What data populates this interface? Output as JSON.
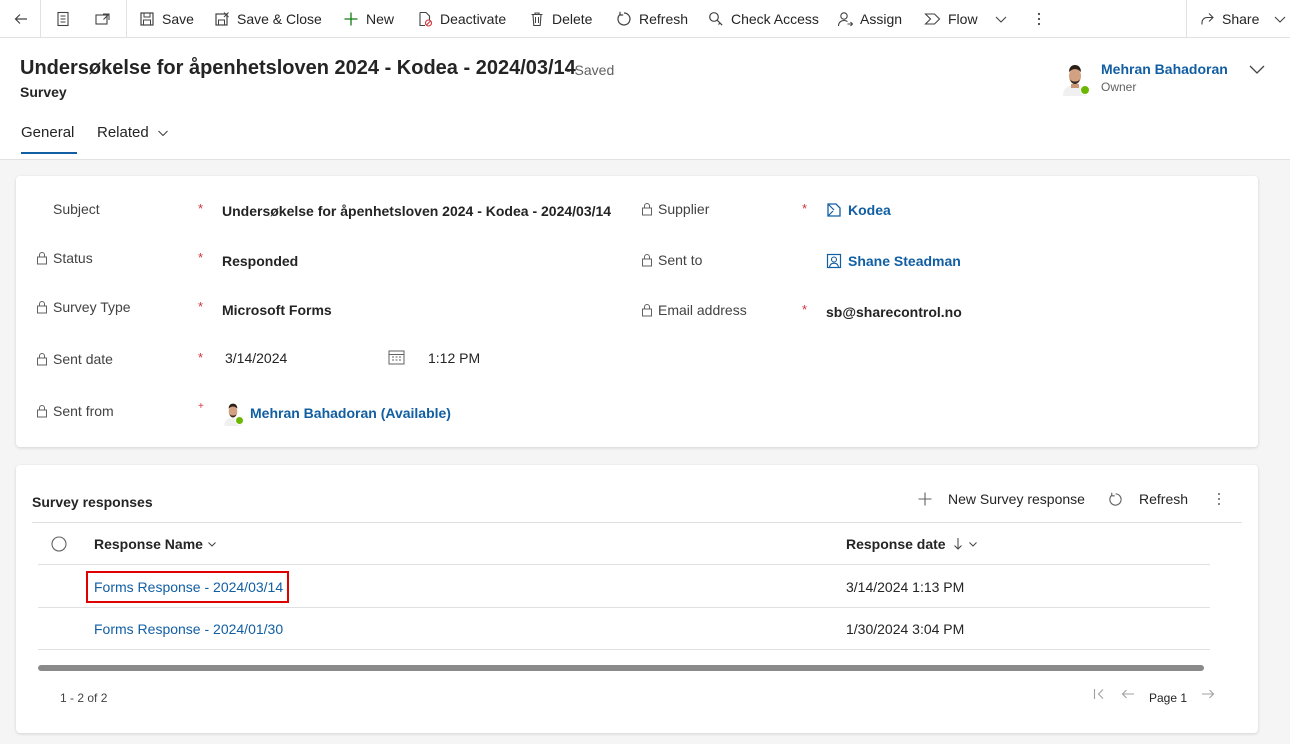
{
  "commandbar": {
    "back_icon": "arrow-left-icon",
    "form_icon": "form-icon",
    "popout_icon": "open-in-new-window-icon",
    "save": "Save",
    "save_close": "Save & Close",
    "new": "New",
    "deactivate": "Deactivate",
    "delete": "Delete",
    "refresh": "Refresh",
    "check_access": "Check Access",
    "assign": "Assign",
    "flow": "Flow",
    "share": "Share"
  },
  "header": {
    "title": "Undersøkelse for åpenhetsloven 2024 - Kodea - 2024/03/14",
    "saved_status": "- Saved",
    "entity": "Survey",
    "owner_name": "Mehran Bahadoran",
    "owner_label": "Owner",
    "presence_color": "#6bb700"
  },
  "tabs": [
    {
      "label": "General",
      "selected": true
    },
    {
      "label": "Related",
      "selected": false
    }
  ],
  "form": {
    "subject": {
      "label": "Subject",
      "value": "Undersøkelse for åpenhetsloven 2024 - Kodea - 2024/03/14",
      "required": "*"
    },
    "status": {
      "label": "Status",
      "value": "Responded",
      "required": "*"
    },
    "survey_type": {
      "label": "Survey Type",
      "value": "Microsoft Forms",
      "required": "*"
    },
    "sent_date": {
      "label": "Sent date",
      "date": "3/14/2024",
      "time": "1:12 PM",
      "required": "*"
    },
    "sent_from": {
      "label": "Sent from",
      "value": "Mehran Bahadoran (Available)",
      "required": "+"
    },
    "supplier": {
      "label": "Supplier",
      "value": "Kodea",
      "required": "*"
    },
    "sent_to": {
      "label": "Sent to",
      "value": "Shane Steadman"
    },
    "email": {
      "label": "Email address",
      "value": "sb@sharecontrol.no",
      "required": "*"
    }
  },
  "grid": {
    "title": "Survey responses",
    "new_label": "New Survey response",
    "refresh_label": "Refresh",
    "columns": [
      "Response Name",
      "Response date"
    ],
    "rows": [
      {
        "name": "Forms Response - 2024/03/14",
        "date": "3/14/2024 1:13 PM",
        "highlighted": true
      },
      {
        "name": "Forms Response - 2024/01/30",
        "date": "1/30/2024 3:04 PM",
        "highlighted": false
      }
    ],
    "count": "1 - 2 of 2",
    "page": "Page 1"
  },
  "colors": {
    "link": "#115ea3",
    "required": "#d13438",
    "highlight": "#e00000"
  }
}
